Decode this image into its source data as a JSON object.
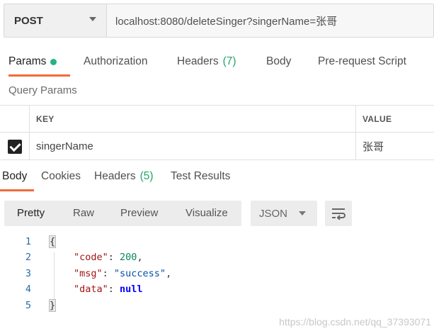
{
  "request": {
    "method": "POST",
    "url": "localhost:8080/deleteSinger?singerName=张哥"
  },
  "request_tabs": {
    "params": "Params",
    "authorization": "Authorization",
    "headers": "Headers",
    "headers_count": "(7)",
    "body": "Body",
    "prerequest": "Pre-request Script"
  },
  "query_params": {
    "label": "Query Params",
    "key_header": "KEY",
    "value_header": "VALUE",
    "rows": [
      {
        "key": "singerName",
        "value": "张哥",
        "checked": true
      }
    ]
  },
  "response_tabs": {
    "body": "Body",
    "cookies": "Cookies",
    "headers": "Headers",
    "headers_count": "(5)",
    "test_results": "Test Results"
  },
  "viewer": {
    "pretty": "Pretty",
    "raw": "Raw",
    "preview": "Preview",
    "visualize": "Visualize",
    "format": "JSON"
  },
  "code": {
    "line_numbers": [
      "1",
      "2",
      "3",
      "4",
      "5"
    ],
    "open": "{",
    "code_key": "\"code\"",
    "code_val": "200",
    "msg_key": "\"msg\"",
    "msg_val": "\"success\"",
    "data_key": "\"data\"",
    "data_val": "null",
    "close": "}"
  },
  "watermark": "https://blog.csdn.net/qq_37393071",
  "colors": {
    "accent": "#f26b3a",
    "success_dot": "#26b47f",
    "count": "#26a269"
  }
}
